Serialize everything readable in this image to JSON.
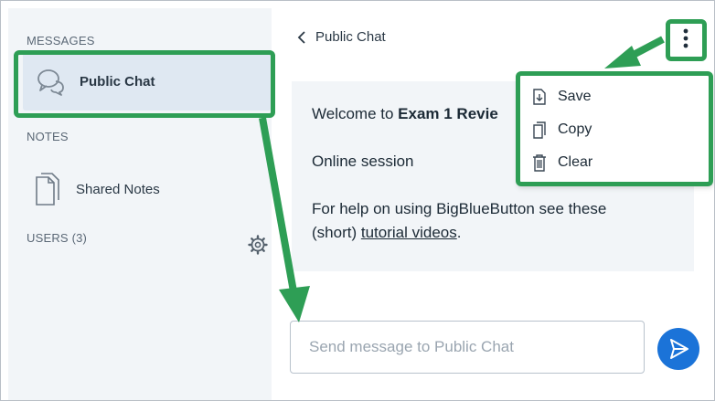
{
  "sidebar": {
    "messages_label": "MESSAGES",
    "public_chat_label": "Public Chat",
    "notes_label": "NOTES",
    "shared_notes_label": "Shared Notes",
    "users_label": "USERS (3)"
  },
  "header": {
    "title": "Public Chat"
  },
  "welcome": {
    "line1_prefix": "Welcome to ",
    "line1_bold": "Exam 1 Revie",
    "line2": "Online session",
    "line3": "For help on using BigBlueButton see these",
    "line4_prefix": "(short) ",
    "line4_link": "tutorial videos",
    "line4_suffix": "."
  },
  "menu": {
    "items": [
      {
        "label": "Save",
        "icon": "save-icon"
      },
      {
        "label": "Copy",
        "icon": "copy-icon"
      },
      {
        "label": "Clear",
        "icon": "trash-icon"
      }
    ]
  },
  "composer": {
    "placeholder": "Send message to Public Chat"
  },
  "colors": {
    "accent": "#1b73d8",
    "callout": "#2e9e55",
    "sidebar_bg": "#f2f5f8",
    "selected_bg": "#dfe8f2"
  }
}
